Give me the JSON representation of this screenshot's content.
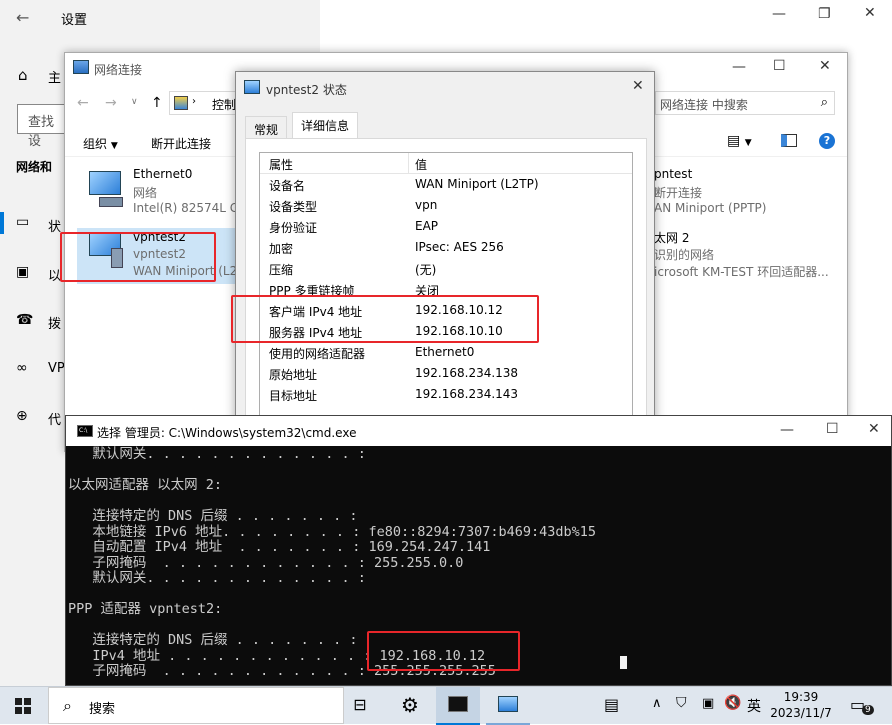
{
  "settings": {
    "title": "设置",
    "home": "主",
    "search_placeholder": "查找设",
    "category": "网络和",
    "items": [
      "状",
      "以",
      "拨",
      "VP",
      "代"
    ]
  },
  "netconn": {
    "title": "网络连接",
    "address": "控制",
    "search_placeholder": "网络连接 中搜索",
    "toolbar": {
      "organize": "组织",
      "disconnect": "断开此连接"
    },
    "connections": [
      {
        "name": "Ethernet0",
        "line2": "网络",
        "line3": "Intel(R) 82574L Gi"
      },
      {
        "name": "vpntest2",
        "line2": "vpntest2",
        "line3": "WAN Miniport (L2"
      },
      {
        "name": "pntest",
        "line2": "断开连接",
        "line3": "AN Miniport (PPTP)"
      },
      {
        "name": "太网 2",
        "line2": "识别的网络",
        "line3": "icrosoft KM-TEST 环回适配器..."
      }
    ]
  },
  "dialog": {
    "title": "vpntest2 状态",
    "tabs": [
      "常规",
      "详细信息"
    ],
    "header": {
      "k": "属性",
      "v": "值"
    },
    "rows": [
      {
        "k": "设备名",
        "v": "WAN Miniport (L2TP)"
      },
      {
        "k": "设备类型",
        "v": "vpn"
      },
      {
        "k": "身份验证",
        "v": "EAP"
      },
      {
        "k": "加密",
        "v": "IPsec: AES 256"
      },
      {
        "k": "压缩",
        "v": "(无)"
      },
      {
        "k": "PPP 多重链接帧",
        "v": "关闭"
      },
      {
        "k": "客户端 IPv4 地址",
        "v": "192.168.10.12"
      },
      {
        "k": "服务器 IPv4 地址",
        "v": "192.168.10.10"
      },
      {
        "k": "使用的网络适配器",
        "v": "Ethernet0"
      },
      {
        "k": "原始地址",
        "v": "192.168.234.138"
      },
      {
        "k": "目标地址",
        "v": "192.168.234.143"
      }
    ]
  },
  "cmd": {
    "title": "选择 管理员: C:\\Windows\\system32\\cmd.exe",
    "lines": [
      "   默认网关. . . . . . . . . . . . . :",
      "",
      "以太网适配器 以太网 2:",
      "",
      "   连接特定的 DNS 后缀 . . . . . . . :",
      "   本地链接 IPv6 地址. . . . . . . . : fe80::8294:7307:b469:43db%15",
      "   自动配置 IPv4 地址  . . . . . . . : 169.254.247.141",
      "   子网掩码  . . . . . . . . . . . . : 255.255.0.0",
      "   默认网关. . . . . . . . . . . . . :",
      "",
      "PPP 适配器 vpntest2:",
      "",
      "   连接特定的 DNS 后缀 . . . . . . . :",
      "   IPv4 地址 . . . . . . . . . . . . : 192.168.10.12",
      "   子网掩码  . . . . . . . . . . . . : 255.255.255.255"
    ]
  },
  "taskbar": {
    "search": "搜索",
    "ime": "英",
    "time": "19:39",
    "date": "2023/11/7",
    "notif_count": "9"
  },
  "colors": {
    "highlight": "#e8262a",
    "accent": "#0078d7",
    "cmd_bg": "#0c0c0c"
  }
}
